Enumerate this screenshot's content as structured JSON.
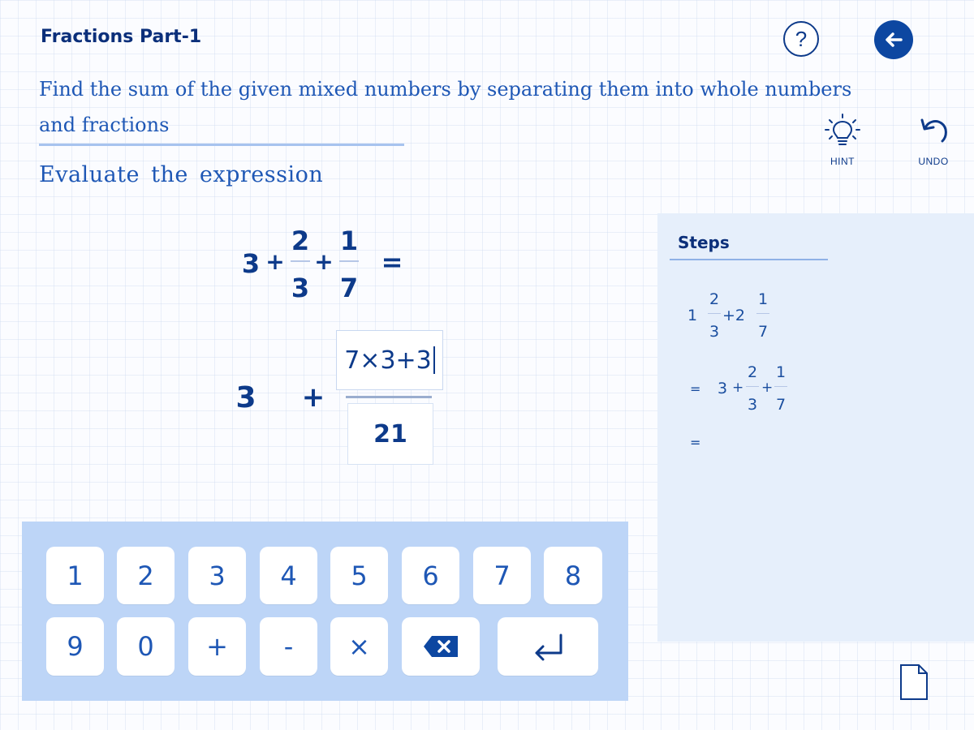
{
  "header": {
    "title": "Fractions Part-1",
    "help_icon": "help-icon",
    "back_icon": "back-arrow-icon"
  },
  "instruction": "Find the sum of the given mixed numbers by separating them into whole numbers and fractions",
  "subheading": "Evaluate  the  expression",
  "tools": {
    "hint_label": "HINT",
    "undo_label": "UNDO"
  },
  "expression": {
    "whole": "3",
    "plus1": "+",
    "frac1_num": "2",
    "frac1_den": "3",
    "plus2": "+",
    "frac2_num": "1",
    "frac2_den": "7",
    "equals": "="
  },
  "answer": {
    "whole": "3",
    "plus": "+",
    "numerator_input": "7×3+3",
    "denominator": "21"
  },
  "steps": {
    "title": "Steps",
    "line1": {
      "w1": "1",
      "n1": "2",
      "d1": "3",
      "op": "+2",
      "n2": "1",
      "d2": "7"
    },
    "line2": {
      "eq": "=",
      "w": "3",
      "p1": "+",
      "n1": "2",
      "d1": "3",
      "p2": "+",
      "n2": "1",
      "d2": "7"
    },
    "line3": {
      "eq": "="
    }
  },
  "keypad": {
    "row1": [
      "1",
      "2",
      "3",
      "4",
      "5",
      "6",
      "7",
      "8"
    ],
    "row2": [
      "9",
      "0",
      "+",
      "-",
      "×"
    ],
    "backspace_icon": "backspace-icon",
    "enter_icon": "enter-icon"
  },
  "footer": {
    "document_icon": "document-icon"
  },
  "colors": {
    "primary": "#0d3a8a",
    "accent": "#1e57b5",
    "panel": "#e6effb",
    "keypad": "#bdd5f7"
  }
}
